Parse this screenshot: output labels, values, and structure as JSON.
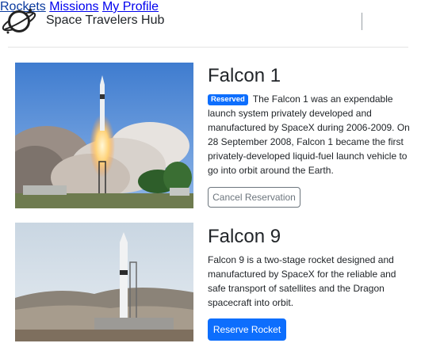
{
  "header": {
    "logo_icon": "planet-icon",
    "title": "Space Travelers Hub",
    "nav": {
      "rockets": "Rockets",
      "missions": "Missions",
      "profile": "My Profile"
    }
  },
  "rockets": [
    {
      "name": "Falcon 1",
      "badge": "Reserved",
      "description": "The Falcon 1 was an expendable launch system privately developed and manufactured by SpaceX during 2006-2009. On 28 September 2008, Falcon 1 became the first privately-developed liquid-fuel launch vehicle to go into orbit around the Earth.",
      "button": "Cancel Reservation",
      "reserved": true
    },
    {
      "name": "Falcon 9",
      "description": "Falcon 9 is a two-stage rocket designed and manufactured by SpaceX for the reliable and safe transport of satellites and the Dragon spacecraft into orbit.",
      "button": "Reserve Rocket",
      "reserved": false
    }
  ],
  "colors": {
    "primary": "#0d6efd",
    "secondary": "#6c757d"
  }
}
